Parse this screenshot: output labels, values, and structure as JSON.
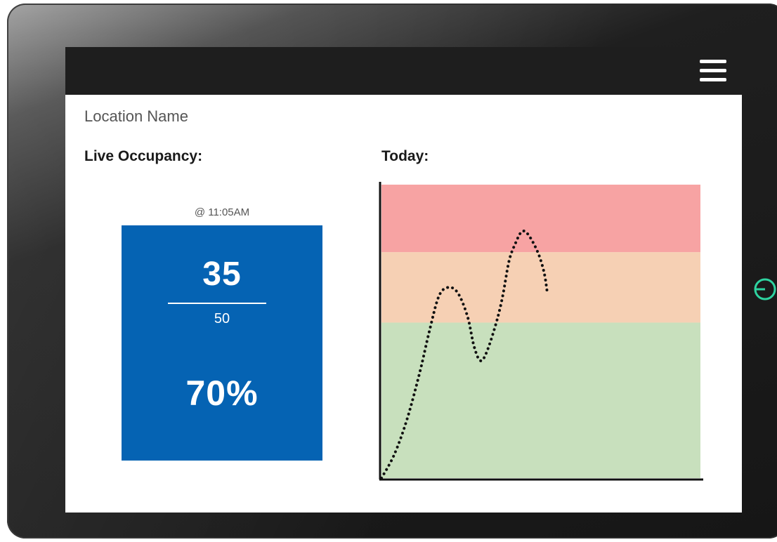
{
  "header": {
    "menu_icon": "hamburger-menu-icon"
  },
  "location": {
    "name": "Location Name"
  },
  "live": {
    "label": "Live Occupancy:",
    "timestamp": "@ 11:05AM",
    "count": "35",
    "capacity": "50",
    "percent": "70%"
  },
  "today": {
    "label": "Today:"
  },
  "device": {
    "power_icon": "power-icon",
    "power_color": "#2ed3a0"
  },
  "colors": {
    "card": "#0563b3",
    "zone_high": "#f7a3a3",
    "zone_mid": "#f6d0b4",
    "zone_low": "#c8e0bd",
    "topbar": "#1e1e1e"
  },
  "chart_data": {
    "type": "line",
    "title": "",
    "xlabel": "",
    "ylabel": "",
    "grid": false,
    "ylim": [
      0,
      100
    ],
    "xlim": [
      0,
      100
    ],
    "zones": [
      {
        "from": 0,
        "to": 53,
        "color": "#c8e0bd"
      },
      {
        "from": 53,
        "to": 77,
        "color": "#f6d0b4"
      },
      {
        "from": 77,
        "to": 100,
        "color": "#f7a3a3"
      }
    ],
    "series": [
      {
        "style": "dotted",
        "color": "#111111",
        "points": [
          [
            0,
            0
          ],
          [
            4,
            8
          ],
          [
            8,
            20
          ],
          [
            12,
            36
          ],
          [
            15,
            50
          ],
          [
            18,
            62
          ],
          [
            21,
            65
          ],
          [
            24,
            63
          ],
          [
            27,
            55
          ],
          [
            29,
            45
          ],
          [
            31,
            40
          ],
          [
            33,
            43
          ],
          [
            36,
            53
          ],
          [
            38,
            62
          ],
          [
            40,
            74
          ],
          [
            42,
            80
          ],
          [
            44,
            84
          ],
          [
            46,
            83
          ],
          [
            49,
            77
          ],
          [
            51,
            70
          ],
          [
            52,
            63
          ]
        ]
      }
    ]
  }
}
